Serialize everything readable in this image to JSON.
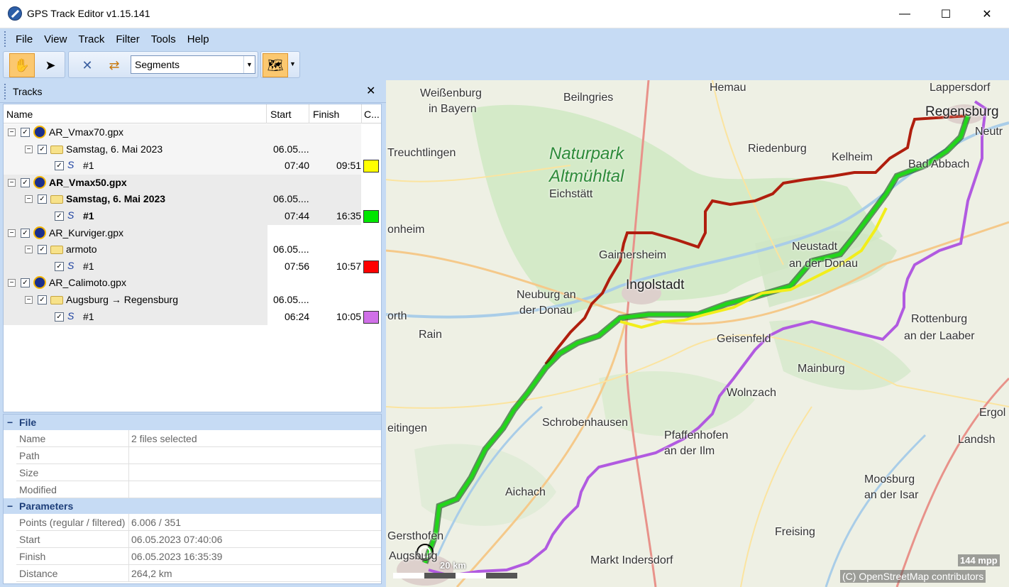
{
  "window": {
    "title": "GPS Track Editor v1.15.141",
    "minimize": "—",
    "maximize": "☐",
    "close": "✕"
  },
  "menu": [
    {
      "label": "File"
    },
    {
      "label": "View"
    },
    {
      "label": "Track"
    },
    {
      "label": "Filter"
    },
    {
      "label": "Tools"
    },
    {
      "label": "Help"
    }
  ],
  "toolbar": {
    "mode_combo_value": "Segments"
  },
  "tracks_panel": {
    "title": "Tracks",
    "close": "✕",
    "columns": {
      "name": "Name",
      "start": "Start",
      "finish": "Finish",
      "color": "C..."
    },
    "rows": [
      {
        "level": 0,
        "label": "AR_Vmax70.gpx",
        "start": "",
        "finish": "",
        "bold": false
      },
      {
        "level": 1,
        "label": "Samstag, 6. Mai 2023",
        "start": "06.05....",
        "finish": "",
        "bold": false
      },
      {
        "level": 2,
        "label": "#1",
        "start": "07:40",
        "finish": "09:51",
        "color": "#ffff00",
        "bold": false
      },
      {
        "level": 0,
        "label": "AR_Vmax50.gpx",
        "start": "",
        "finish": "",
        "bold": true
      },
      {
        "level": 1,
        "label": "Samstag, 6. Mai 2023",
        "start": "06.05....",
        "finish": "",
        "bold": true
      },
      {
        "level": 2,
        "label": "#1",
        "start": "07:44",
        "finish": "16:35",
        "color": "#00e600",
        "bold": true
      },
      {
        "level": 0,
        "label": "AR_Kurviger.gpx",
        "start": "",
        "finish": "",
        "bold": false
      },
      {
        "level": 1,
        "label": "armoto",
        "start": "06.05....",
        "finish": "",
        "bold": false
      },
      {
        "level": 2,
        "label": "#1",
        "start": "07:56",
        "finish": "10:57",
        "color": "#ff0000",
        "bold": false
      },
      {
        "level": 0,
        "label": "AR_Calimoto.gpx",
        "start": "",
        "finish": "",
        "bold": false
      },
      {
        "level": 1,
        "label": "Augsburg → Regensburg",
        "start": "06.05....",
        "finish": "",
        "bold": false
      },
      {
        "level": 2,
        "label": "#1",
        "start": "06:24",
        "finish": "10:05",
        "color": "#d070e8",
        "bold": false
      }
    ]
  },
  "properties": {
    "file_category": "File",
    "file_rows": [
      {
        "key": "Name",
        "value": "2 files selected"
      },
      {
        "key": "Path",
        "value": ""
      },
      {
        "key": "Size",
        "value": ""
      },
      {
        "key": "Modified",
        "value": ""
      }
    ],
    "params_category": "Parameters",
    "param_rows": [
      {
        "key": "Points (regular / filtered)",
        "value": "6.006 / 351"
      },
      {
        "key": "Start",
        "value": "06.05.2023 07:40:06"
      },
      {
        "key": "Finish",
        "value": "06.05.2023 16:35:39"
      },
      {
        "key": "Distance",
        "value": "264,2 km"
      }
    ]
  },
  "map": {
    "labels": [
      "Weißenburg",
      "in Bayern",
      "Beilngries",
      "Hemau",
      "Lappersdorf",
      "Regensburg",
      "Neutr",
      "Treuchtlingen",
      "Naturpark",
      "Altmühltal",
      "Riedenburg",
      "Kelheim",
      "Bad Abbach",
      "Eichstätt",
      "onheim",
      "Gaimersheim",
      "Neustadt",
      "an der Donau",
      "Ingolstadt",
      "Neuburg an",
      "der Donau",
      "orth",
      "Rain",
      "Geisenfeld",
      "Rottenburg",
      "an der Laaber",
      "Mainburg",
      "Wolnzach",
      "Schrobenhausen",
      "Pfaffenhofen",
      "an der Ilm",
      "Ergol",
      "Landsh",
      "eitingen",
      "Aichach",
      "Moosburg",
      "an der Isar",
      "Gersthofen",
      "Freising",
      "Augsburg",
      "Markt Indersdorf"
    ],
    "scale_label": "20 km",
    "mpp": "144 mpp",
    "attribution": "(C) OpenStreetMap contributors",
    "track_colors": {
      "red": "#b01e0e",
      "green": "#22d61a",
      "yellow": "#f2ee1a",
      "purple": "#b15ae0"
    }
  }
}
